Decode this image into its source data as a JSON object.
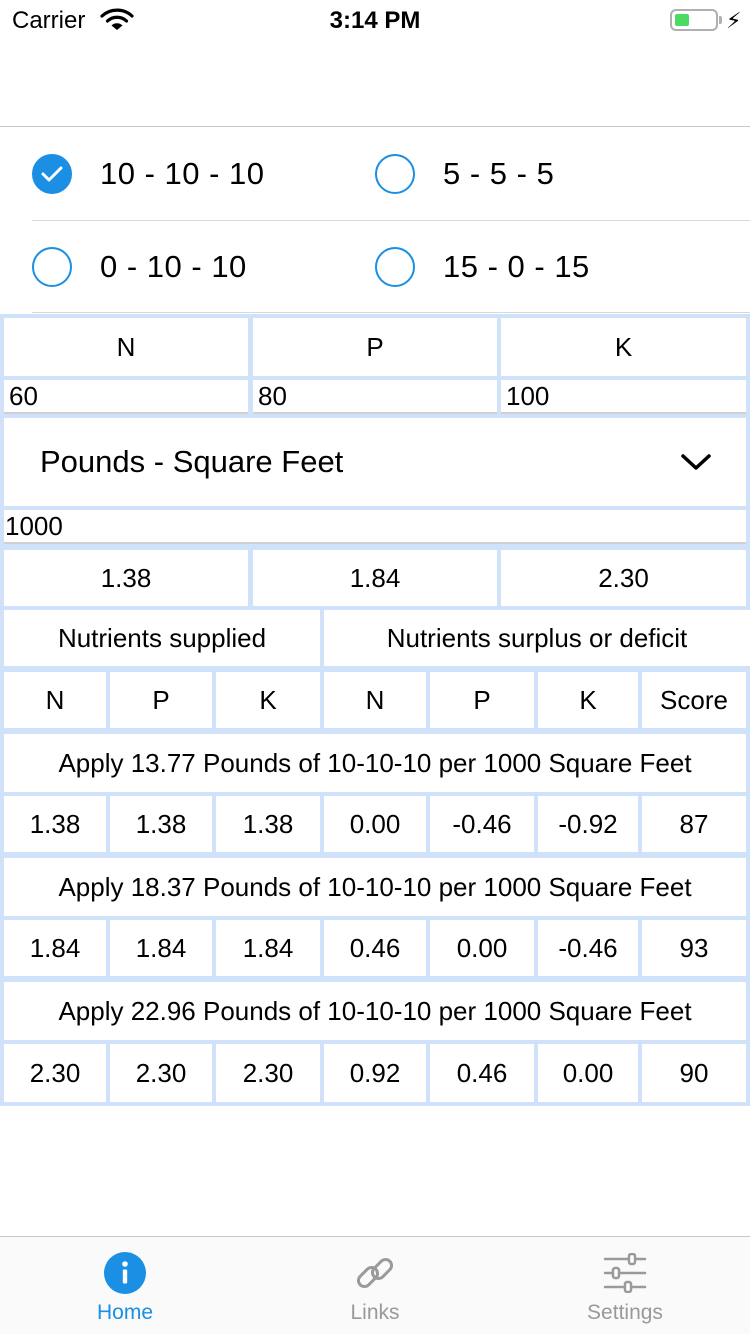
{
  "status_bar": {
    "carrier": "Carrier",
    "time": "3:14 PM"
  },
  "options": [
    {
      "label": "10 - 10 - 10",
      "checked": true
    },
    {
      "label": "5 - 5 - 5",
      "checked": false
    },
    {
      "label": "0 - 10 - 10",
      "checked": false
    },
    {
      "label": "15 - 0 - 15",
      "checked": false
    }
  ],
  "npk_headers": [
    "N",
    "P",
    "K"
  ],
  "npk_inputs": [
    "60",
    "80",
    "100"
  ],
  "unit_select": "Pounds - Square Feet",
  "area_input": "1000",
  "per_area_values": [
    "1.38",
    "1.84",
    "2.30"
  ],
  "section_headers": {
    "supplied": "Nutrients supplied",
    "surplus": "Nutrients surplus or deficit"
  },
  "column_headers": [
    "N",
    "P",
    "K",
    "N",
    "P",
    "K",
    "Score"
  ],
  "results": [
    {
      "instruction": "Apply 13.77 Pounds of 10-10-10 per 1000 Square Feet",
      "values": [
        "1.38",
        "1.38",
        "1.38",
        "0.00",
        "-0.46",
        "-0.92",
        "87"
      ]
    },
    {
      "instruction": "Apply 18.37 Pounds of 10-10-10 per 1000 Square Feet",
      "values": [
        "1.84",
        "1.84",
        "1.84",
        "0.46",
        "0.00",
        "-0.46",
        "93"
      ]
    },
    {
      "instruction": "Apply 22.96 Pounds of 10-10-10 per 1000 Square Feet",
      "values": [
        "2.30",
        "2.30",
        "2.30",
        "0.92",
        "0.46",
        "0.00",
        "90"
      ]
    }
  ],
  "tabs": [
    {
      "label": "Home",
      "icon": "info-icon",
      "active": true
    },
    {
      "label": "Links",
      "icon": "link-icon",
      "active": false
    },
    {
      "label": "Settings",
      "icon": "sliders-icon",
      "active": false
    }
  ],
  "colors": {
    "accent": "#1a8fe3",
    "grid_border": "#cfe2f9",
    "inactive": "#999999"
  }
}
